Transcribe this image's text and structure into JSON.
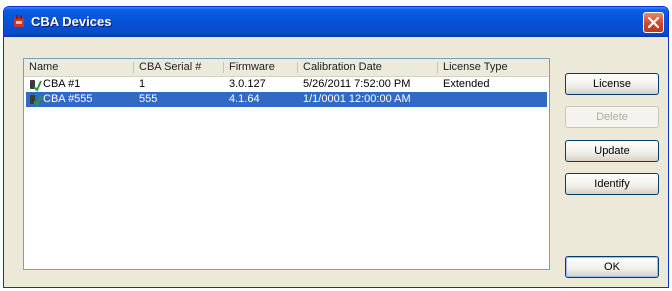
{
  "window": {
    "title": "CBA Devices"
  },
  "list": {
    "columns": [
      "Name",
      "CBA Serial #",
      "Firmware",
      "Calibration Date",
      "License Type"
    ],
    "rows": [
      {
        "name": "CBA #1",
        "serial": "1",
        "firmware": "3.0.127",
        "calibration_date": "5/26/2011 7:52:00 PM",
        "license_type": "Extended",
        "selected": false
      },
      {
        "name": "CBA #555",
        "serial": "555",
        "firmware": "4.1.64",
        "calibration_date": "1/1/0001 12:00:00 AM",
        "license_type": "",
        "selected": true
      }
    ]
  },
  "buttons": {
    "license": "License",
    "delete": "Delete",
    "update": "Update",
    "identify": "Identify",
    "ok": "OK"
  },
  "icons": {
    "app": "cba-device-icon",
    "close": "close-icon",
    "row": "device-connected-icon"
  },
  "colors": {
    "titlebar": "#0552d6",
    "selection": "#316ac5",
    "close": "#d2452c"
  }
}
